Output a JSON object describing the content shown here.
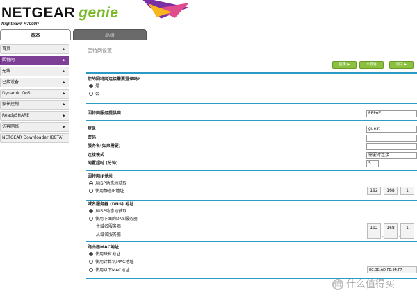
{
  "brand": {
    "name": "NETGEAR",
    "product": "genie",
    "model": "Nighthawk R7000P"
  },
  "tabs": [
    {
      "label": "基本"
    },
    {
      "label": "高级"
    }
  ],
  "sidebar": {
    "items": [
      {
        "label": "首页"
      },
      {
        "label": "因特网"
      },
      {
        "label": "无线"
      },
      {
        "label": "已接设备"
      },
      {
        "label": "Dynamic QoS"
      },
      {
        "label": "家长控制"
      },
      {
        "label": "ReadySHARE"
      },
      {
        "label": "访客网络"
      },
      {
        "label": "NETGEAR Downloader (BETA)"
      }
    ]
  },
  "page": {
    "title": "因特网设置"
  },
  "buttons": {
    "apply": "应用 ▶",
    "cancel": "✕取消",
    "test": "测试 ▶"
  },
  "login_question": {
    "label": "您的因特网连接需要登录吗?",
    "options": [
      "是",
      "否"
    ],
    "selected": "是"
  },
  "isp": {
    "label": "因特网服务提供商",
    "value": "PPPoE"
  },
  "fields": {
    "login_label": "登录",
    "login_value": "guest",
    "password_label": "密码",
    "service_label": "服务名(如果需要)",
    "mode_label": "连接模式",
    "mode_value": "需要时连接",
    "idle_label": "闲置超时 (分钟)",
    "idle_value": "5"
  },
  "ip_section": {
    "title": "因特网IP地址",
    "options": [
      "从ISP动态地获取",
      "使用静态IP地址"
    ],
    "selected": "从ISP动态地获取",
    "ip": [
      "192",
      "168",
      "1"
    ]
  },
  "dns_section": {
    "title": "域名服务器 (DNS) 地址",
    "options": [
      "从ISP动态地获取",
      "使用下面的DNS服务器"
    ],
    "selected": "从ISP动态地获取",
    "primary_label": "主域名服务器",
    "secondary_label": "从域名服务器",
    "primary_ip": [
      "192",
      "168",
      "1"
    ]
  },
  "mac_section": {
    "title": "路由器MAC地址",
    "options": [
      "使用缺省地址",
      "使用计算机MAC地址",
      "使用以下MAC地址"
    ],
    "selected": "使用缺省地址",
    "mac_value": "8C:3B:AD:FB:94:F7"
  },
  "watermark": {
    "text": "什么值得买"
  },
  "colors": {
    "accent": "#7d3f96",
    "divider": "#2a9bc4",
    "button": "#8cc13f",
    "genie": "#7cba2c"
  }
}
